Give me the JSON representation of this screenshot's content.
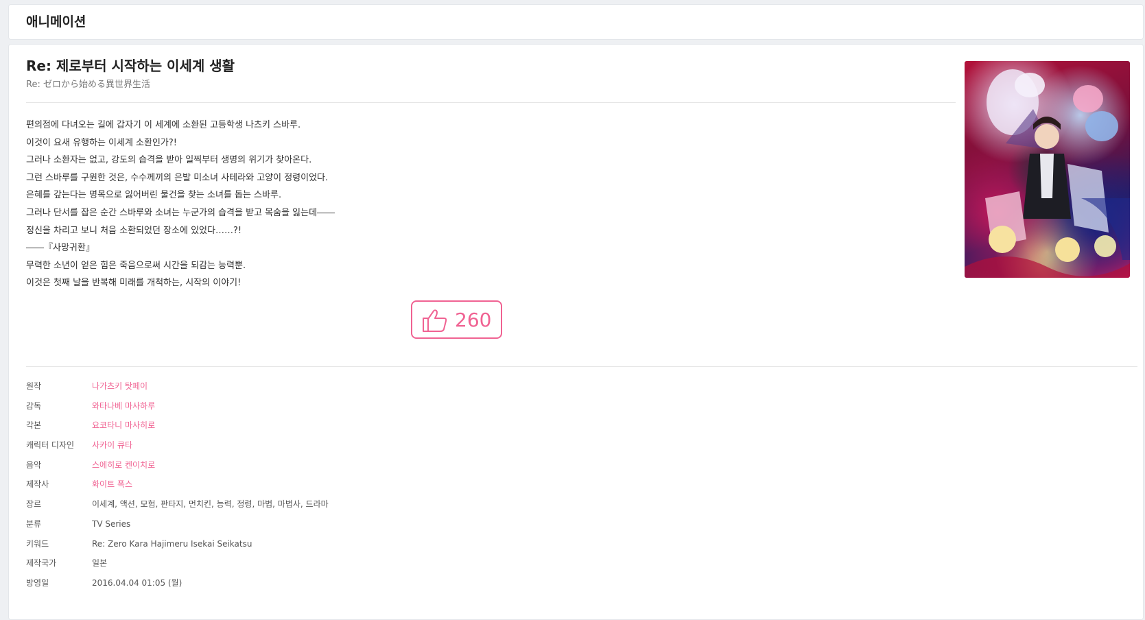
{
  "header": {
    "title": "애니메이션"
  },
  "anime": {
    "title": "Re: 제로부터 시작하는 이세계 생활",
    "subtitle": "Re: ゼロから始める異世界生活",
    "synopsis": [
      "편의점에 다녀오는 길에 갑자기 이 세계에 소환된 고등학생 나츠키 스바루.",
      "이것이 요새 유행하는 이세계 소환인가?!",
      "그러나 소환자는 없고, 강도의 습격을 받아 일찍부터 생명의 위기가 찾아온다.",
      "그런 스바루를 구원한 것은, 수수께끼의 은발 미소녀 사테라와 고양이 정령이었다.",
      "은혜를 갚는다는 명목으로 잃어버린 물건을 찾는 소녀를 돕는 스바루.",
      "그러나 단서를 잡은 순간 스바루와 소녀는 누군가의 습격을 받고 목숨을 잃는데――",
      "정신을 차리고 보니 처음 소환되었던 장소에 있었다……?!",
      "――『사망귀환』",
      "무력한 소년이 얻은 힘은 죽음으로써 시간을 되감는 능력뿐.",
      "이것은 첫째 날을 반복해 미래를 개척하는, 시작의 이야기!"
    ],
    "likes": "260",
    "poster_icon": "anime-poster-image"
  },
  "info": {
    "original_label": "원작",
    "original_value": "나가츠키 탓페이",
    "director_label": "감독",
    "director_value": "와타나베 마사하루",
    "script_label": "각본",
    "script_value": "요코타니 마사히로",
    "character_label": "캐릭터 디자인",
    "character_value": "사카이 큐타",
    "music_label": "음악",
    "music_value": "스에히로 켄이치로",
    "studio_label": "제작사",
    "studio_value": "화이트 폭스",
    "genre_label": "장르",
    "genre_value": "이세계, 액션, 모험, 판타지, 먼치킨, 능력, 정령, 마법, 마법사, 드라마",
    "category_label": "분류",
    "category_value": "TV Series",
    "keyword_label": "키워드",
    "keyword_value": "Re: Zero Kara Hajimeru Isekai Seikatsu",
    "country_label": "제작국가",
    "country_value": "일본",
    "airdate_label": "방영일",
    "airdate_value": "2016.04.04 01:05 (월)"
  },
  "colors": {
    "accent": "#f06292",
    "text": "#333333",
    "muted": "#777777",
    "background": "#eef0f3"
  }
}
